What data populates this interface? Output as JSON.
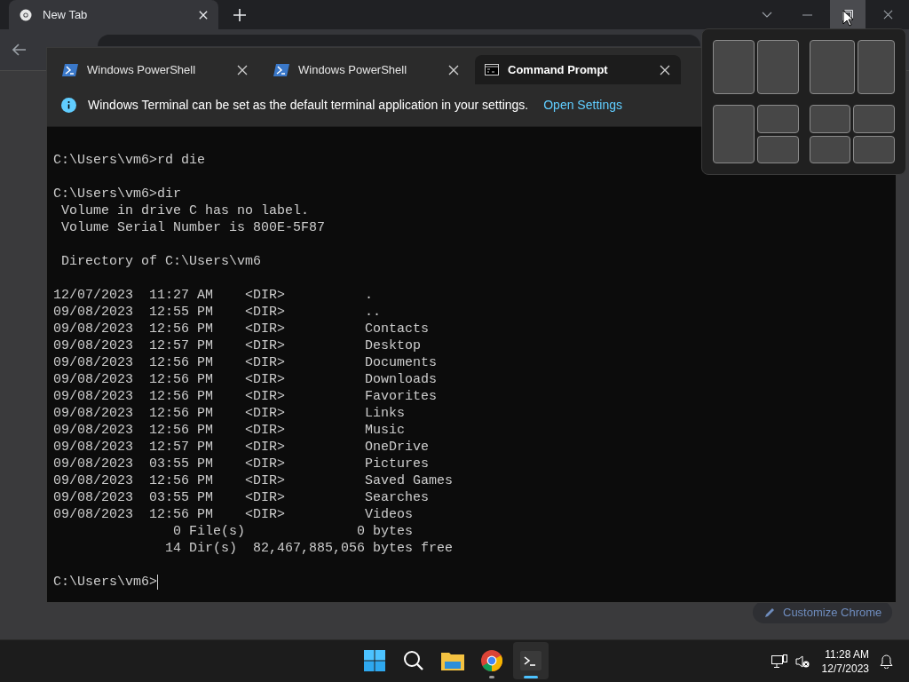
{
  "browser": {
    "tab": {
      "title": "New Tab"
    },
    "customize_button": "Customize Chrome"
  },
  "terminal": {
    "tabs": [
      {
        "title": "Windows PowerShell",
        "kind": "powershell",
        "selected": false
      },
      {
        "title": "Windows PowerShell",
        "kind": "powershell",
        "selected": false
      },
      {
        "title": "Command Prompt",
        "kind": "cmd",
        "selected": true
      }
    ],
    "infobar": {
      "message": "Windows Terminal can be set as the default terminal application in your settings.",
      "link": "Open Settings"
    },
    "blocks": [
      [
        "C:\\Users\\vm6>rd die"
      ],
      [
        "C:\\Users\\vm6>dir",
        " Volume in drive C has no label.",
        " Volume Serial Number is 800E-5F87"
      ],
      [
        " Directory of C:\\Users\\vm6"
      ],
      [
        "12/07/2023  11:27 AM    <DIR>          .",
        "09/08/2023  12:55 PM    <DIR>          ..",
        "09/08/2023  12:56 PM    <DIR>          Contacts",
        "09/08/2023  12:57 PM    <DIR>          Desktop",
        "09/08/2023  12:56 PM    <DIR>          Documents",
        "09/08/2023  12:56 PM    <DIR>          Downloads",
        "09/08/2023  12:56 PM    <DIR>          Favorites",
        "09/08/2023  12:56 PM    <DIR>          Links",
        "09/08/2023  12:56 PM    <DIR>          Music",
        "09/08/2023  12:57 PM    <DIR>          OneDrive",
        "09/08/2023  03:55 PM    <DIR>          Pictures",
        "09/08/2023  12:56 PM    <DIR>          Saved Games",
        "09/08/2023  03:55 PM    <DIR>          Searches",
        "09/08/2023  12:56 PM    <DIR>          Videos",
        "               0 File(s)              0 bytes",
        "              14 Dir(s)  82,467,885,056 bytes free"
      ],
      [
        "C:\\Users\\vm6>"
      ]
    ]
  },
  "snap_layouts": [
    {
      "kind": "halves"
    },
    {
      "kind": "wide-left"
    },
    {
      "kind": "left-stack"
    },
    {
      "kind": "quad"
    }
  ],
  "taskbar": {
    "apps": [
      {
        "kind": "start",
        "running": false,
        "selected": false
      },
      {
        "kind": "search",
        "running": false,
        "selected": false
      },
      {
        "kind": "folder",
        "running": false,
        "selected": false
      },
      {
        "kind": "browser",
        "running": true,
        "selected": false
      },
      {
        "kind": "terminal",
        "running": true,
        "selected": true
      }
    ],
    "clock": {
      "time": "11:28 AM",
      "date": "12/7/2023"
    }
  }
}
